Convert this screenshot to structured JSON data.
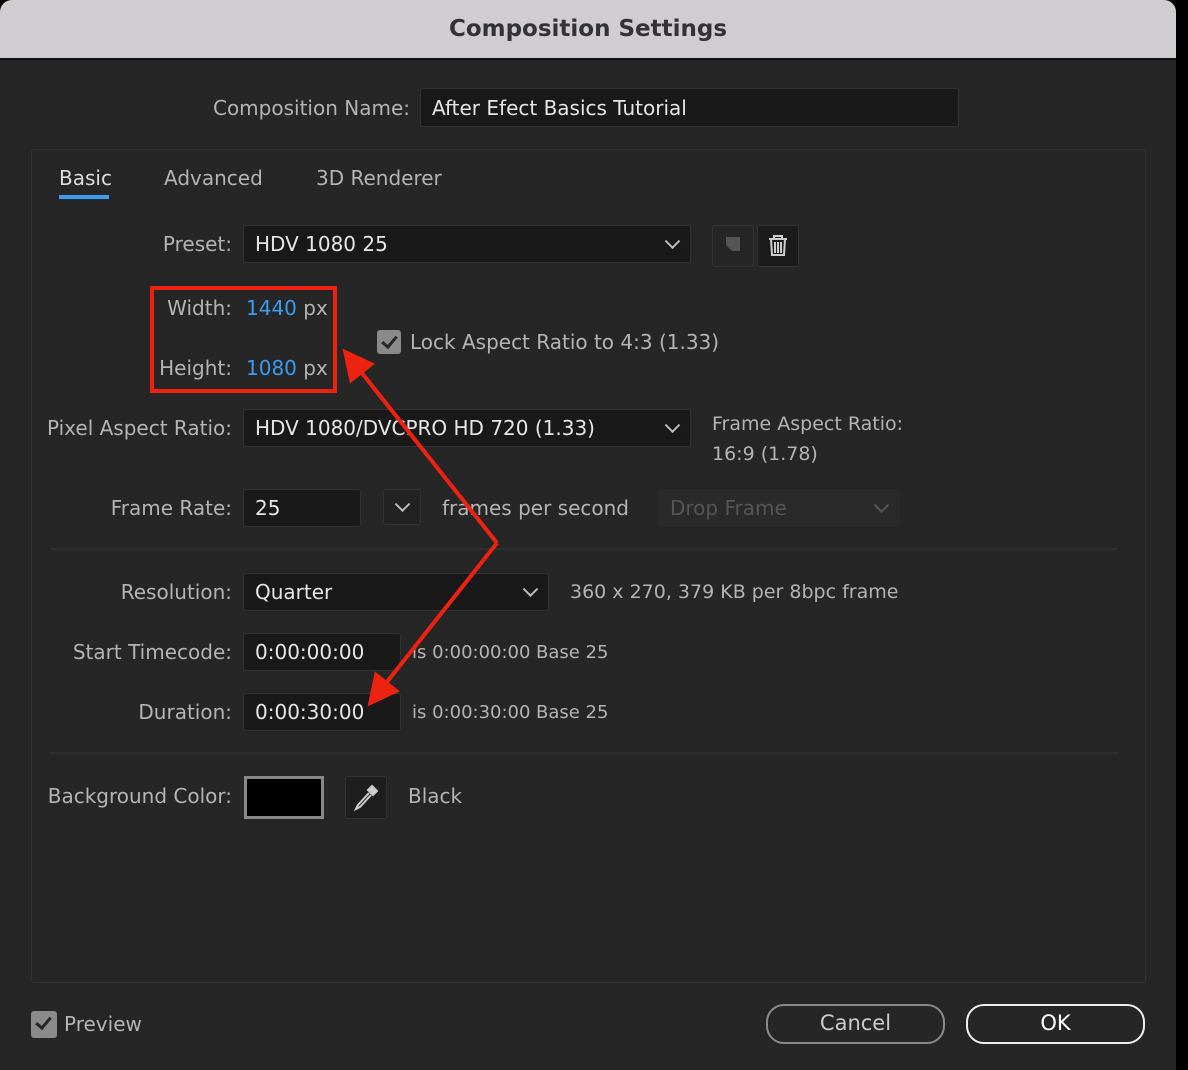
{
  "dialog": {
    "title": "Composition Settings"
  },
  "comp_name": {
    "label": "Composition Name:",
    "value": "After Efect  Basics Tutorial"
  },
  "tabs": [
    {
      "label": "Basic",
      "active": true
    },
    {
      "label": "Advanced"
    },
    {
      "label": "3D Renderer"
    }
  ],
  "preset": {
    "label": "Preset:",
    "value": "HDV 1080 25"
  },
  "width": {
    "label": "Width:",
    "value": "1440",
    "unit": "px"
  },
  "height": {
    "label": "Height:",
    "value": "1080",
    "unit": "px"
  },
  "lock_aspect": {
    "label": "Lock Aspect Ratio to 4:3 (1.33)",
    "checked": true
  },
  "pixel_aspect": {
    "label": "Pixel Aspect Ratio:",
    "value": "HDV 1080/DVCPRO HD 720 (1.33)"
  },
  "frame_aspect": {
    "label": "Frame Aspect Ratio:",
    "value": "16:9 (1.78)"
  },
  "frame_rate": {
    "label": "Frame Rate:",
    "value": "25",
    "suffix": "frames per second",
    "drop_frame": "Drop Frame"
  },
  "resolution": {
    "label": "Resolution:",
    "value": "Quarter",
    "info": "360 x 270, 379 KB per 8bpc frame"
  },
  "start_timecode": {
    "label": "Start Timecode:",
    "value": "0:00:00:00",
    "is": "is 0:00:00:00",
    "base": "Base 25"
  },
  "duration": {
    "label": "Duration:",
    "value": "0:00:30:00",
    "is": "is 0:00:30:00",
    "base": "Base 25"
  },
  "background": {
    "label": "Background Color:",
    "color": "#000000",
    "name": "Black"
  },
  "footer": {
    "preview_label": "Preview",
    "preview_checked": true,
    "cancel": "Cancel",
    "ok": "OK"
  },
  "annotation_color": "#ee2211",
  "accent_color": "#3b9cf0"
}
